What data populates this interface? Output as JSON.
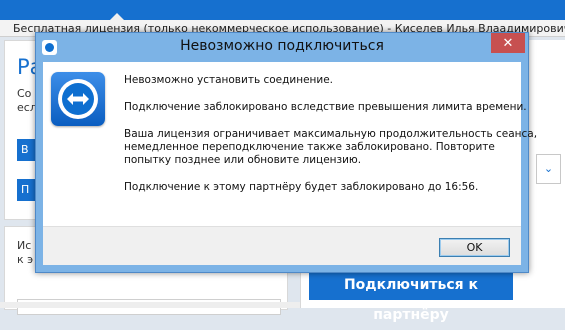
{
  "license_bar": {
    "text": "Бесплатная лицензия (только некоммерческое использование) - Киселев Илья Влаадимирович"
  },
  "background": {
    "left_heading_fragment": "Ра",
    "left_line1_fragment": "Со",
    "left_line2_fragment": "есл",
    "button1_fragment": "В",
    "button2_fragment": "П",
    "lower_line1_fragment": "Ис",
    "lower_line2_fragment": "к э",
    "combo_arrow": "⌄",
    "connect_button": "Подключиться к партнёру"
  },
  "dialog": {
    "title": "Невозможно подключиться",
    "close_glyph": "✕",
    "messages": {
      "line1": "Невозможно установить соединение.",
      "line2": "Подключение заблокировано вследствие превышения лимита времени.",
      "line3a": "Ваша лицензия ограничивает максимальную продолжительность сеанса,",
      "line3b": "немедленное переподключение также заблокировано. Повторите",
      "line3c": "попытку позднее или обновите лицензию.",
      "line4": "Подключение к этому партнёру будет заблокировано до 16:56."
    },
    "ok_label": "OK"
  },
  "icons": {
    "app_icon": "teamviewer-icon",
    "logo": "teamviewer-logo"
  },
  "colors": {
    "accent": "#1670cf",
    "dialog_frame": "#7cb3e6",
    "close_button": "#c75050"
  }
}
